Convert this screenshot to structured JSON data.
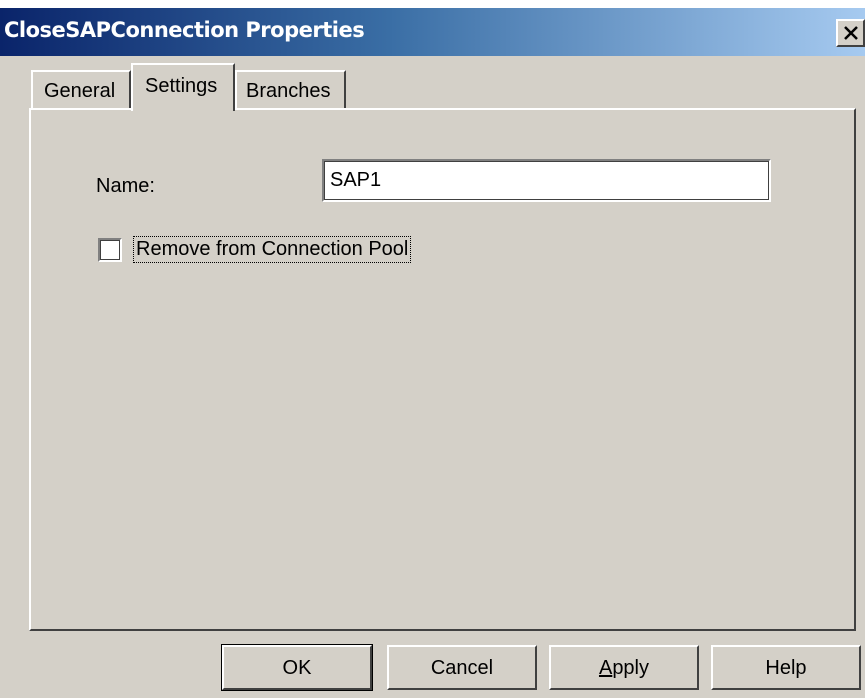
{
  "window": {
    "title": "CloseSAPConnection Properties",
    "close_glyph": "×"
  },
  "tabs": [
    {
      "label": "General",
      "selected": false
    },
    {
      "label": "Settings",
      "selected": true
    },
    {
      "label": "Branches",
      "selected": false
    }
  ],
  "settings": {
    "name_label": "Name:",
    "name_value": "SAP1",
    "remove_label": "Remove from Connection Pool",
    "remove_checked": false
  },
  "buttons": {
    "ok": "OK",
    "cancel": "Cancel",
    "apply": "Apply",
    "help": "Help"
  },
  "colors": {
    "title_start": "#0a246a",
    "title_end": "#a6caf0",
    "face": "#d4d0c8"
  }
}
